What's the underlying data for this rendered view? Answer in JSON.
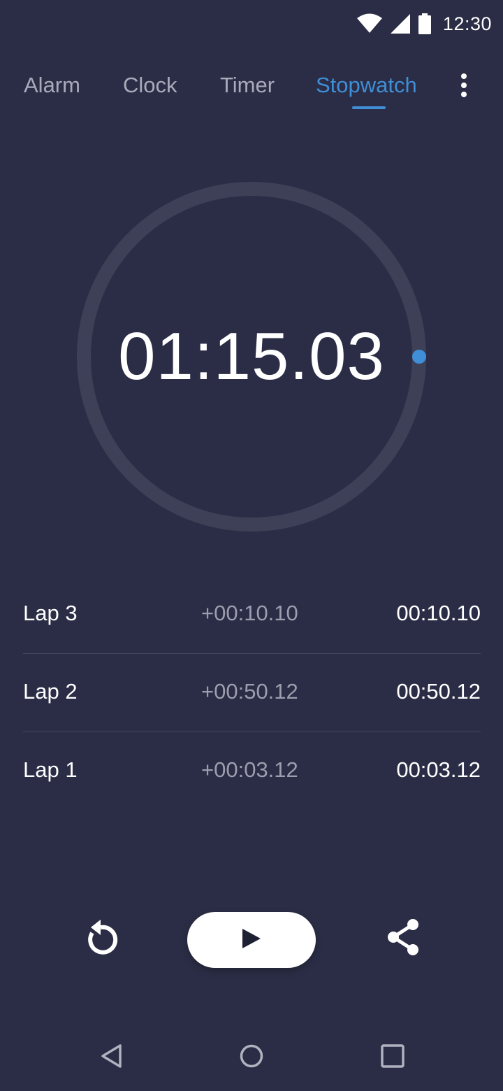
{
  "status_bar": {
    "time": "12:30",
    "icons": [
      "wifi-icon",
      "signal-icon",
      "battery-icon"
    ]
  },
  "tabs": [
    {
      "label": "Alarm",
      "active": false
    },
    {
      "label": "Clock",
      "active": false
    },
    {
      "label": "Timer",
      "active": false
    },
    {
      "label": "Stopwatch",
      "active": true
    }
  ],
  "menu_icon": "more-vert-icon",
  "stopwatch": {
    "elapsed": "01:15.03"
  },
  "laps": [
    {
      "name": "Lap 3",
      "diff": "+00:10.10",
      "total": "00:10.10"
    },
    {
      "name": "Lap 2",
      "diff": "+00:50.12",
      "total": "00:50.12"
    },
    {
      "name": "Lap 1",
      "diff": "+00:03.12",
      "total": "00:03.12"
    }
  ],
  "controls": {
    "reset_icon": "reset-icon",
    "play_icon": "play-icon",
    "share_icon": "share-icon"
  },
  "nav_bar": {
    "icons": [
      "back-icon",
      "home-icon",
      "recents-icon"
    ]
  },
  "colors": {
    "background": "#2a2d45",
    "accent": "#3f8ed6",
    "ring": "#3d4056",
    "text_muted": "#a9abbb"
  }
}
